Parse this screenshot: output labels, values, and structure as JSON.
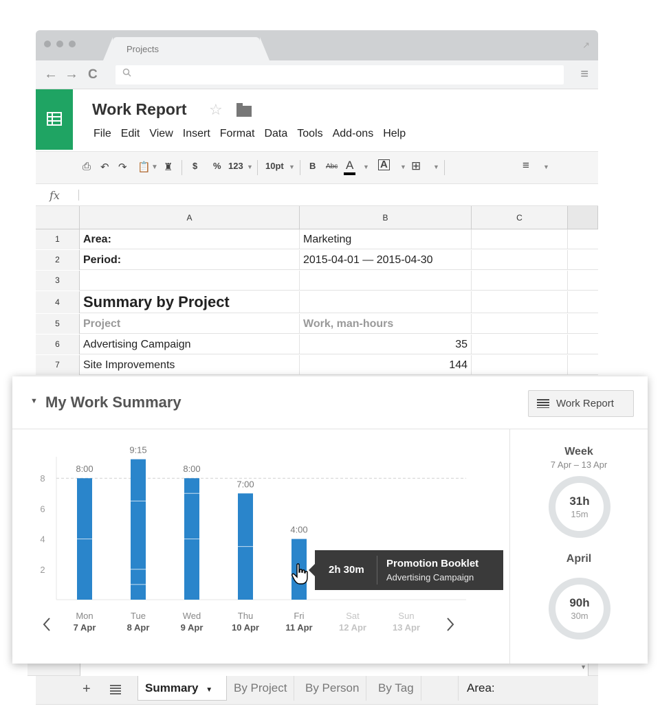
{
  "browser": {
    "tab_title": "Projects"
  },
  "sheet": {
    "title": "Work Report",
    "menu": [
      "File",
      "Edit",
      "View",
      "Insert",
      "Format",
      "Data",
      "Tools",
      "Add-ons",
      "Help"
    ],
    "toolbar": {
      "currency": "$",
      "percent": "%",
      "number_format": "123",
      "font_size": "10pt",
      "bold": "B",
      "strike": "Abc",
      "text_color": "A"
    },
    "formula_symbol": "fx",
    "columns": [
      "A",
      "B",
      "C"
    ],
    "rows": [
      {
        "num": "1",
        "a": "Area:",
        "b": "Marketing",
        "style": "bold-a"
      },
      {
        "num": "2",
        "a": "Period:",
        "b": "2015-04-01 — 2015-04-30",
        "style": "bold-a"
      },
      {
        "num": "3",
        "a": "",
        "b": "",
        "style": ""
      },
      {
        "num": "4",
        "a": "Summary by Project",
        "b": "",
        "style": "big"
      },
      {
        "num": "5",
        "a": "Project",
        "b": "Work, man-hours",
        "style": "gray"
      },
      {
        "num": "6",
        "a": "Advertising Campaign",
        "b": "35",
        "style": "num"
      },
      {
        "num": "7",
        "a": "Site Improvements",
        "b": "144",
        "style": "num"
      }
    ],
    "sheet_tabs": [
      "Summary",
      "By Project",
      "By Person",
      "By Tag"
    ],
    "active_tab": "Summary",
    "area_cell": "Area:"
  },
  "panel": {
    "title": "My Work Summary",
    "report_button": "Work Report",
    "week_title": "Week",
    "week_range": "7 Apr – 13 Apr",
    "week_hours": "31h",
    "week_minutes": "15m",
    "month_title": "April",
    "month_hours": "90h",
    "month_minutes": "30m",
    "tooltip": {
      "duration": "2h 30m",
      "task": "Promotion Booklet",
      "project": "Advertising Campaign"
    }
  },
  "colors": {
    "bar": "#2a85cb",
    "sheets_green": "#1fa463",
    "ring": "#dfe2e4"
  },
  "chart_data": {
    "type": "bar",
    "categories": [
      "Mon",
      "Tue",
      "Wed",
      "Thu",
      "Fri",
      "Sat",
      "Sun"
    ],
    "dates": [
      "7 Apr",
      "8 Apr",
      "9 Apr",
      "10 Apr",
      "11 Apr",
      "12 Apr",
      "13 Apr"
    ],
    "values": [
      8,
      9.25,
      8,
      7,
      4,
      0,
      0
    ],
    "value_labels": [
      "8:00",
      "9:15",
      "8:00",
      "7:00",
      "4:00",
      "",
      ""
    ],
    "segments": [
      [
        4,
        4
      ],
      [
        1,
        1,
        4.5,
        2.75
      ],
      [
        4,
        3,
        1
      ],
      [
        3.5,
        3.5
      ],
      [
        1.5,
        2.5
      ],
      [],
      []
    ],
    "yticks": [
      2,
      4,
      6,
      8
    ],
    "ylim": [
      0,
      9.5
    ],
    "target_line": 8,
    "weekend_muted": [
      false,
      false,
      false,
      false,
      false,
      true,
      true
    ],
    "grid": false
  }
}
